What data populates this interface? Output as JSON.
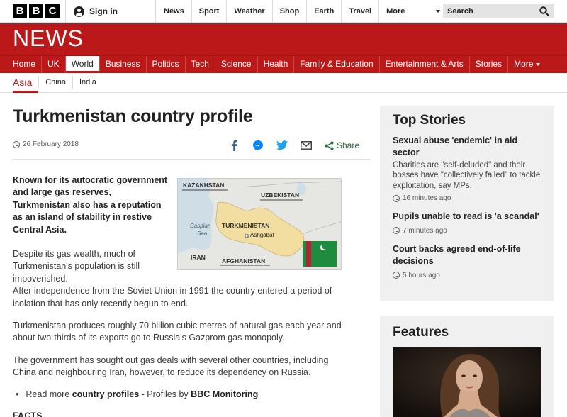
{
  "header": {
    "logo_letters": [
      "B",
      "B",
      "C"
    ],
    "signin_label": "Sign in",
    "nav": [
      "News",
      "Sport",
      "Weather",
      "Shop",
      "Earth",
      "Travel",
      "More"
    ],
    "search_placeholder": "Search"
  },
  "banner": {
    "title": "NEWS"
  },
  "main_nav": {
    "items": [
      "Home",
      "UK",
      "World",
      "Business",
      "Politics",
      "Tech",
      "Science",
      "Health",
      "Family & Education",
      "Entertainment & Arts",
      "Stories",
      "More"
    ],
    "active": "World"
  },
  "sub_nav": {
    "active": "Asia",
    "items": [
      "China",
      "India"
    ]
  },
  "article": {
    "title": "Turkmenistan country profile",
    "date": "26 February 2018",
    "share_label": "Share",
    "intro": "Known for its autocratic government and large gas reserves, Turkmenistan also has a reputation as an island of stability in restive Central Asia.",
    "p1_first": "Despite its gas wealth, much of Turkmenistan's population is still impoverished.",
    "p1_rest": "After independence from the Soviet Union in 1991 the country entered a period of isolation that has only recently begun to end.",
    "p2": "Turkmenistan produces roughly 70 billion cubic metres of natural gas each year and about two-thirds of its exports go to Russia's Gazprom gas monopoly.",
    "p3": "The government has sought out gas deals with several other countries, including China and neighbouring Iran, however, to reduce its dependency on Russia.",
    "bullet": {
      "prefix": "Read more",
      "link": "country profiles",
      "middle": "- Profiles by",
      "source": "BBC Monitoring"
    },
    "facts_heading": "FACTS"
  },
  "map": {
    "labels": {
      "kazakhstan": "KAZAKHSTAN",
      "uzbekistan": "UZBEKISTAN",
      "caspian": "Caspian",
      "sea": "Sea",
      "turkmenistan": "TURKMENISTAN",
      "ashgabat": "Ashgabat",
      "iran": "IRAN",
      "afghanistan": "AFGHANISTAN"
    },
    "colors": {
      "water": "#cfdde6",
      "land": "#e6e6e3",
      "country": "#f2dea0",
      "flag_green": "#1e8c3e",
      "flag_red": "#b22234"
    }
  },
  "sidebar": {
    "top_stories_title": "Top Stories",
    "stories": [
      {
        "headline": "Sexual abuse 'endemic' in aid sector",
        "summary": "Charities are \"self-deluded\" and their bosses have \"collectively failed\" to tackle exploitation, say MPs.",
        "time": "16 minutes ago"
      },
      {
        "headline": "Pupils unable to read is 'a scandal'",
        "time": "7 minutes ago"
      },
      {
        "headline": "Court backs agreed end-of-life decisions",
        "time": "5 hours ago"
      }
    ],
    "features_title": "Features"
  },
  "colors": {
    "brand_red": "#bb1919",
    "share_green": "#2a6a45",
    "facebook_blue": "#3b5998",
    "twitter_blue": "#1da1f2"
  }
}
